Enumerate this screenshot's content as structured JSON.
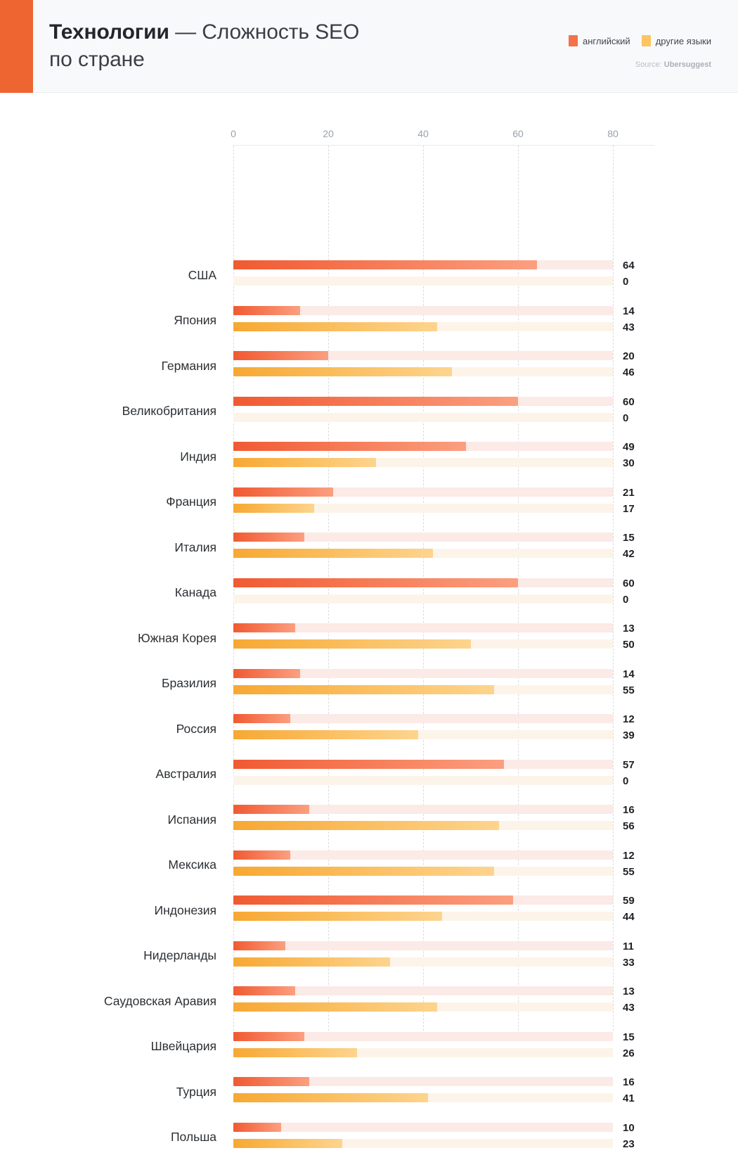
{
  "header": {
    "title_strong": "Технологии",
    "title_rest": " — Сложность SEO",
    "title_line2": "по стране",
    "accent_color": "#ee6532",
    "legend": [
      {
        "label": "английский",
        "color": "#f4714a",
        "icon": "legend-swatch-icon"
      },
      {
        "label": "другие языки",
        "color": "#fcc462",
        "icon": "legend-swatch-icon"
      }
    ],
    "source_prefix": "Source: ",
    "source_name": "Ubersuggest"
  },
  "chart_data": {
    "type": "bar",
    "orientation": "horizontal",
    "title": "Технологии — Сложность SEO по стране",
    "xlabel": "",
    "ylabel": "",
    "xlim": [
      0,
      80
    ],
    "ticks": [
      "0",
      "20",
      "40",
      "60",
      "80"
    ],
    "tick_values": [
      0,
      20,
      40,
      60,
      80
    ],
    "grid": true,
    "legend_position": "top-right",
    "categories": [
      "США",
      "Япония",
      "Германия",
      "Великобритания",
      "Индия",
      "Франция",
      "Италия",
      "Канада",
      "Южная Корея",
      "Бразилия",
      "Россия",
      "Австралия",
      "Испания",
      "Мексика",
      "Индонезия",
      "Нидерланды",
      "Саудовская Аравия",
      "Швейцария",
      "Турция",
      "Польша"
    ],
    "series": [
      {
        "name": "английский",
        "color": "#f4714a",
        "values": [
          64,
          14,
          20,
          60,
          49,
          21,
          15,
          60,
          13,
          14,
          12,
          57,
          16,
          12,
          59,
          11,
          13,
          15,
          16,
          10
        ]
      },
      {
        "name": "другие языки",
        "color": "#fcc462",
        "values": [
          0,
          43,
          46,
          0,
          30,
          17,
          42,
          0,
          50,
          55,
          39,
          0,
          56,
          55,
          44,
          33,
          43,
          26,
          41,
          23
        ]
      }
    ]
  }
}
